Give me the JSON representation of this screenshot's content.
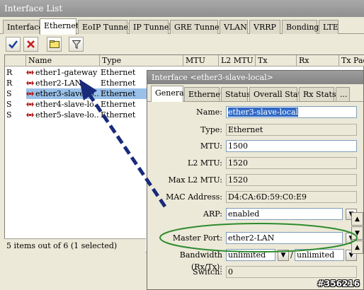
{
  "window": {
    "title": "Interface List"
  },
  "tabs": [
    "Interface",
    "Ethernet",
    "EoIP Tunnel",
    "IP Tunnel",
    "GRE Tunnel",
    "VLAN",
    "VRRP",
    "Bonding",
    "LTE"
  ],
  "active_tab": "Ethernet",
  "toolbar": {
    "icons": [
      "check-icon",
      "x-icon",
      "note-icon",
      "filter-icon"
    ]
  },
  "columns": [
    "Name",
    "Type",
    "MTU",
    "L2 MTU",
    "Tx",
    "Rx",
    "Tx Pac"
  ],
  "rows": [
    {
      "flag": "R",
      "name": "ether1-gateway",
      "type": "Ethernet"
    },
    {
      "flag": "R",
      "name": "ether2-LAN",
      "type": "Ethernet"
    },
    {
      "flag": "S",
      "name": "ether3-slave-lo...",
      "type": "Ethernet"
    },
    {
      "flag": "S",
      "name": "ether4-slave-lo...",
      "type": "Ethernet"
    },
    {
      "flag": "S",
      "name": "ether5-slave-lo...",
      "type": "Ethernet"
    }
  ],
  "status": "5 items out of 6 (1 selected)",
  "dialog": {
    "title": "Interface <ether3-slave-local>",
    "tabs": [
      "General",
      "Ethernet",
      "Status",
      "Overall Stats",
      "Rx Stats",
      "..."
    ],
    "fields": {
      "name": {
        "label": "Name:",
        "value": "ether3-slave-local"
      },
      "type": {
        "label": "Type:",
        "value": "Ethernet"
      },
      "mtu": {
        "label": "MTU:",
        "value": "1500"
      },
      "l2mtu": {
        "label": "L2 MTU:",
        "value": "1520"
      },
      "maxl2mtu": {
        "label": "Max L2 MTU:",
        "value": "1520"
      },
      "mac": {
        "label": "MAC Address:",
        "value": "D4:CA:6D:59:C0:E9"
      },
      "arp": {
        "label": "ARP:",
        "value": "enabled"
      },
      "master": {
        "label": "Master Port:",
        "value": "ether2-LAN"
      },
      "bandwidth": {
        "label": "Bandwidth (Rx/Tx):",
        "rx": "unlimited",
        "sep": "/",
        "tx": "unlimited"
      },
      "switch": {
        "label": "Switch:",
        "value": "0"
      }
    }
  },
  "watermark": "#356216",
  "colors": {
    "selection": "#99c0e8",
    "annotation_arrow": "#1a2a7a",
    "annotation_ellipse": "#2e8b2e"
  }
}
